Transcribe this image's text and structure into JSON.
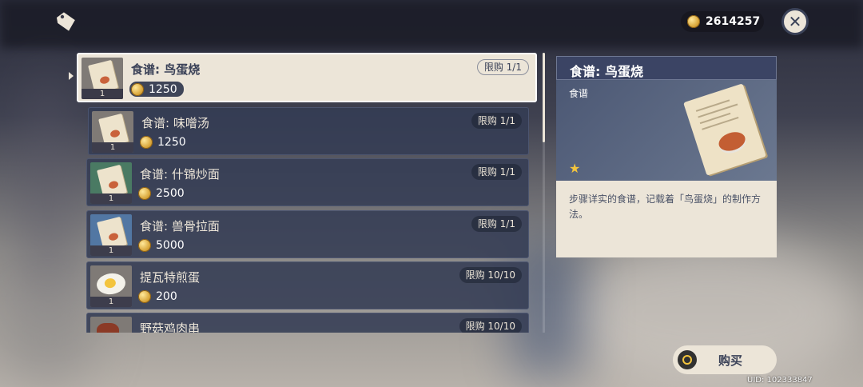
{
  "header": {
    "mora_amount": "2614257",
    "icons": {
      "shop": "price-tag-icon",
      "currency": "mora-coin-icon",
      "close": "close-icon"
    }
  },
  "shop_list": {
    "items": [
      {
        "name": "食谱: 鸟蛋烧",
        "price": "1250",
        "limit": "限购 1/1",
        "qty": "1",
        "icon": "recipe-icon",
        "selected": true
      },
      {
        "name": "食谱: 味噌汤",
        "price": "1250",
        "limit": "限购 1/1",
        "qty": "1",
        "icon": "recipe-icon"
      },
      {
        "name": "食谱: 什锦炒面",
        "price": "2500",
        "limit": "限购 1/1",
        "qty": "1",
        "icon": "recipe-icon"
      },
      {
        "name": "食谱: 兽骨拉面",
        "price": "5000",
        "limit": "限购 1/1",
        "qty": "1",
        "icon": "recipe-icon"
      },
      {
        "name": "提瓦特煎蛋",
        "price": "200",
        "limit": "限购 10/10",
        "qty": "1",
        "icon": "fried-egg-icon"
      },
      {
        "name": "野菇鸡肉串",
        "price": "",
        "limit": "限购 10/10",
        "qty": "",
        "icon": "skewer-icon"
      }
    ]
  },
  "detail": {
    "title": "食谱: 鸟蛋烧",
    "category": "食谱",
    "stars": "★",
    "description": "步骤详实的食谱，记载着「鸟蛋烧」的制作方法。"
  },
  "footer": {
    "buy_label": "购买",
    "uid": "UID: 102333847"
  },
  "colors": {
    "accent": "#ece5d8",
    "panel": "#3b4464",
    "gold": "#f3c43d"
  }
}
